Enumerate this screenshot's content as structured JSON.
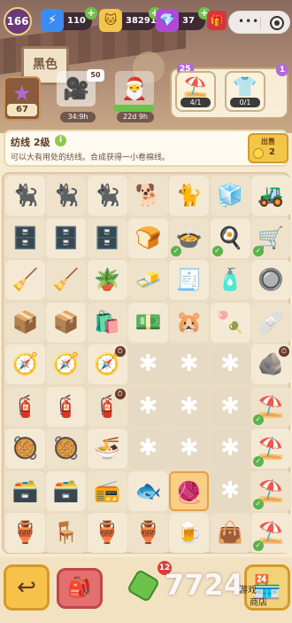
{
  "scene": {
    "sign_text": "黑色"
  },
  "player": {
    "level": "166"
  },
  "resources": {
    "energy": {
      "value": "110",
      "icon": "lightning-icon",
      "color": "#3b8cf0"
    },
    "coins": {
      "value": "38291",
      "icon": "cat-coin-icon",
      "color": "#f3c64a"
    },
    "gems": {
      "value": "37",
      "icon": "gem-icon",
      "color": "#b04ad6"
    }
  },
  "quests": {
    "star_count": "67",
    "camera": {
      "badge": "50",
      "timer": "34:9h"
    },
    "santa": {
      "timer": "22d 9h"
    },
    "orders_badge": "25",
    "orders_badge_right": "1",
    "orders": [
      {
        "icon": "market-stall-icon",
        "progress": "4/1"
      },
      {
        "icon": "tshirt-icon",
        "progress": "0/1"
      }
    ]
  },
  "info": {
    "title": "纺线 2级",
    "description": "可以大有用处的纺线。合成获得一小卷棉线。",
    "sell_label": "出售",
    "sell_price": "2"
  },
  "board": {
    "rows": [
      [
        {
          "e": "🐈‍⬛",
          "n": "cat-icon"
        },
        {
          "e": "🐈‍⬛",
          "n": "cat-icon"
        },
        {
          "e": "🐈‍⬛",
          "n": "cat-icon"
        },
        {
          "e": "🐕",
          "n": "shiba-icon"
        },
        {
          "e": "🐈",
          "n": "orange-cat-icon"
        },
        {
          "e": "🧊",
          "n": "fridge-icon"
        },
        {
          "e": "🚜",
          "n": "toy-car-icon"
        }
      ],
      [
        {
          "e": "🗄️",
          "n": "shelf-icon"
        },
        {
          "e": "🗄️",
          "n": "shelf-icon"
        },
        {
          "e": "🗄️",
          "n": "shelf-icon"
        },
        {
          "e": "🍞",
          "n": "bread-basket-icon"
        },
        {
          "e": "🍲",
          "n": "hotpot-icon",
          "check": true
        },
        {
          "e": "🍳",
          "n": "pan-icon",
          "check": true
        },
        {
          "e": "🛒",
          "n": "cart-icon",
          "check": true
        }
      ],
      [
        {
          "e": "🧹",
          "n": "vacuum-icon"
        },
        {
          "e": "🧹",
          "n": "mop-icon"
        },
        {
          "e": "🪴",
          "n": "sprout-broom-icon"
        },
        {
          "e": "🧈",
          "n": "butter-icon"
        },
        {
          "e": "🧾",
          "n": "paper-stack-icon"
        },
        {
          "e": "🧴",
          "n": "spray-bottle-icon"
        },
        {
          "e": "🔘",
          "n": "button-icon"
        }
      ],
      [
        {
          "e": "📦",
          "n": "red-box-icon"
        },
        {
          "e": "📦",
          "n": "red-box-icon"
        },
        {
          "e": "🛍️",
          "n": "paper-bag-icon"
        },
        {
          "e": "💵",
          "n": "cash-stack-icon"
        },
        {
          "e": "🐹",
          "n": "hamster-icon"
        },
        {
          "e": "🍡",
          "n": "skewer-icon"
        },
        {
          "e": "🩹",
          "n": "bandage-icon"
        }
      ],
      [
        {
          "e": "🧭",
          "n": "mortar-icon"
        },
        {
          "e": "🧭",
          "n": "mortar-icon"
        },
        {
          "e": "🧭",
          "n": "mortar-icon",
          "clock": true
        },
        {
          "e": "",
          "n": "empty-cell",
          "locked": true
        },
        {
          "e": "",
          "n": "empty-cell",
          "locked": true
        },
        {
          "e": "",
          "n": "empty-cell",
          "locked": true
        },
        {
          "e": "🪨",
          "n": "green-rock-icon",
          "clock": true
        }
      ],
      [
        {
          "e": "🧯",
          "n": "tool-icon"
        },
        {
          "e": "🧯",
          "n": "tool-icon"
        },
        {
          "e": "🧯",
          "n": "tool-icon",
          "clock": true
        },
        {
          "e": "",
          "n": "empty-cell",
          "locked": true
        },
        {
          "e": "",
          "n": "empty-cell",
          "locked": true
        },
        {
          "e": "",
          "n": "empty-cell",
          "locked": true
        },
        {
          "e": "⛱️",
          "n": "market-stall-icon",
          "check": true
        }
      ],
      [
        {
          "e": "🥘",
          "n": "stew-icon"
        },
        {
          "e": "🥘",
          "n": "stew-icon"
        },
        {
          "e": "🍜",
          "n": "noodle-bowl-icon"
        },
        {
          "e": "",
          "n": "empty-cell",
          "locked": true
        },
        {
          "e": "",
          "n": "empty-cell",
          "locked": true
        },
        {
          "e": "",
          "n": "empty-cell",
          "locked": true
        },
        {
          "e": "⛱️",
          "n": "market-stall-icon",
          "check": true
        }
      ],
      [
        {
          "e": "🗃️",
          "n": "cabinet-icon"
        },
        {
          "e": "🗃️",
          "n": "cabinet-icon"
        },
        {
          "e": "📻",
          "n": "oven-icon"
        },
        {
          "e": "🐟",
          "n": "goldfish-icon"
        },
        {
          "e": "🧶",
          "n": "yarn-icon",
          "selected": true
        },
        {
          "e": "",
          "n": "empty-cell",
          "locked": true
        },
        {
          "e": "⛱️",
          "n": "market-stall-icon",
          "check": true
        }
      ],
      [
        {
          "e": "🏺",
          "n": "jar-icon"
        },
        {
          "e": "🪑",
          "n": "chair-icon"
        },
        {
          "e": "🏺",
          "n": "jar-icon"
        },
        {
          "e": "🏺",
          "n": "jar-icon"
        },
        {
          "e": "🍺",
          "n": "barrel-icon"
        },
        {
          "e": "👜",
          "n": "handbag-icon"
        },
        {
          "e": "⛱️",
          "n": "market-stall-icon",
          "check": true
        }
      ]
    ]
  },
  "bottom": {
    "back_icon": "back-arrow-icon",
    "bag_icon": "backpack-icon",
    "energy_badge": "12",
    "shop_icon": "shop-icon",
    "watermark": "7724",
    "watermark_sub1": "游戏",
    "watermark_sub2": "商店"
  }
}
